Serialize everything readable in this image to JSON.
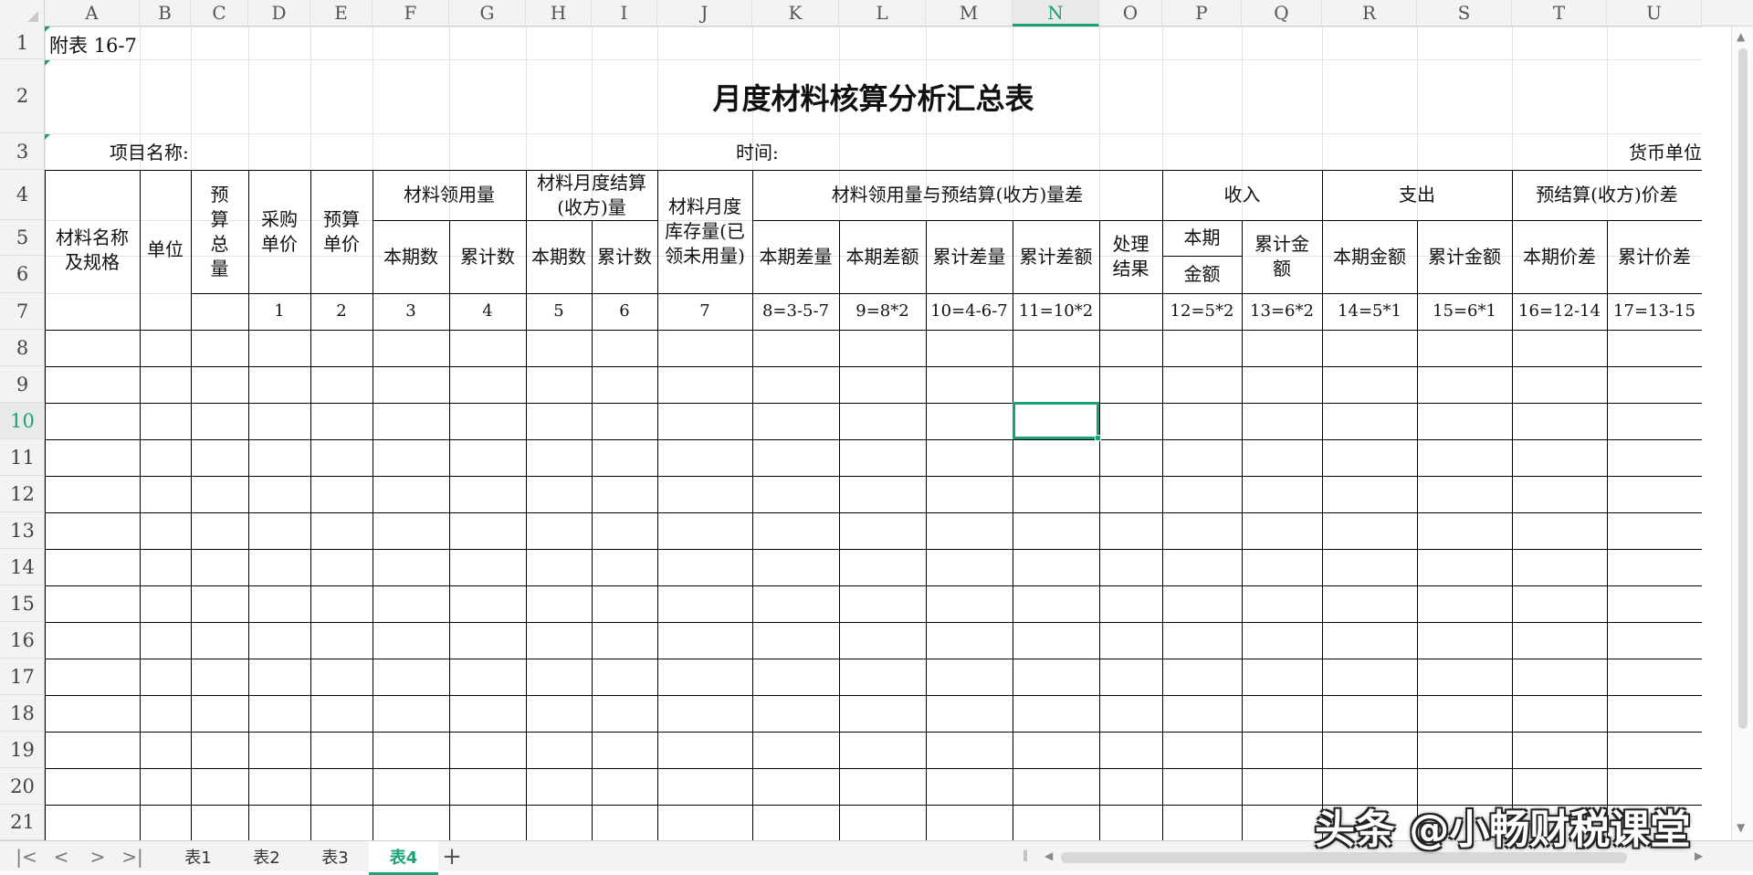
{
  "spreadsheet": {
    "columns": [
      "A",
      "B",
      "C",
      "D",
      "E",
      "F",
      "G",
      "H",
      "I",
      "J",
      "K",
      "L",
      "M",
      "N",
      "O",
      "P",
      "Q",
      "R",
      "S",
      "T",
      "U"
    ],
    "active_column": "N",
    "rows": [
      "1",
      "2",
      "3",
      "4",
      "5",
      "6",
      "7",
      "8",
      "9",
      "10",
      "11",
      "12",
      "13",
      "14",
      "15",
      "16",
      "17",
      "18",
      "19",
      "20",
      "21"
    ],
    "active_row": "10"
  },
  "sheet": {
    "attachment_label": "附表 16-7",
    "title": "月度材料核算分析汇总表",
    "project_name_label": "项目名称:",
    "time_label": "时间:",
    "currency_label": "货币单位"
  },
  "table_headers": {
    "material_name": "材料名称及规格",
    "unit": "单位",
    "budget_total": "预算总量",
    "purchase_price": "采购单价",
    "budget_price": "预算单价",
    "usage": "材料领用量",
    "usage_current": "本期数",
    "usage_cumulative": "累计数",
    "settlement": "材料月度结算(收方)量",
    "settlement_current": "本期数",
    "settlement_cumulative": "累计数",
    "inventory": "材料月度库存量(已领未用量)",
    "diff_group": "材料领用量与预结算(收方)量差",
    "diff_qty_current": "本期差量",
    "diff_amt_current": "本期差额",
    "diff_qty_cumulative": "累计差量",
    "diff_amt_cumulative": "累计差额",
    "handling_result": "处理结果",
    "income": "收入",
    "income_current_a": "本期",
    "income_current_b": "金额",
    "income_cumulative": "累计金额",
    "expense": "支出",
    "expense_current": "本期金额",
    "expense_cumulative": "累计金额",
    "price_diff": "预结算(收方)价差",
    "price_diff_current": "本期价差",
    "price_diff_cumulative": "累计价差"
  },
  "formula_row": [
    "1",
    "2",
    "3",
    "4",
    "5",
    "6",
    "7",
    "8=3-5-7",
    "9=8*2",
    "10=4-6-7",
    "11=10*2",
    "12=5*2",
    "13=6*2",
    "14=5*1",
    "15=6*1",
    "16=12-14",
    "17=13-15"
  ],
  "sheet_tabs": [
    "表1",
    "表2",
    "表3",
    "表4"
  ],
  "active_tab": "表4",
  "add_sheet_symbol": "+",
  "nav_buttons": [
    "|<",
    "<",
    ">",
    ">|"
  ],
  "watermark": "头条 @小畅财税课堂",
  "colors": {
    "accent": "#1aa179",
    "grid": "#e3e3e3",
    "border": "#000000"
  }
}
